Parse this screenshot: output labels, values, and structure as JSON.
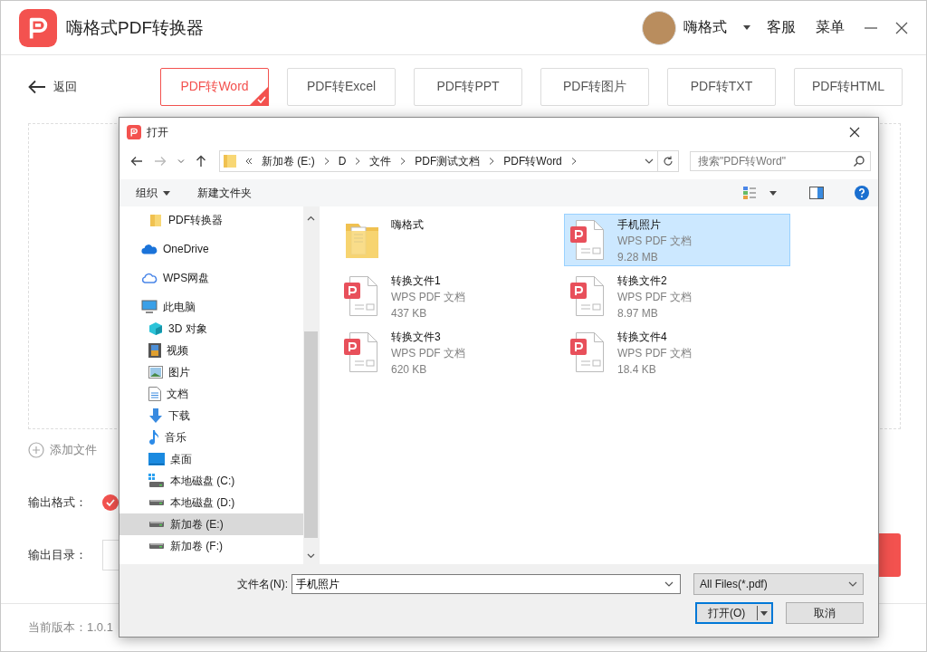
{
  "app": {
    "title": "嗨格式PDF转换器",
    "user_name": "嗨格式",
    "header_links": [
      "客服",
      "菜单"
    ]
  },
  "back_label": "返回",
  "tabs": [
    {
      "label": "PDF转Word",
      "selected": true
    },
    {
      "label": "PDF转Excel",
      "selected": false
    },
    {
      "label": "PDF转PPT",
      "selected": false
    },
    {
      "label": "PDF转图片",
      "selected": false
    },
    {
      "label": "PDF转TXT",
      "selected": false
    },
    {
      "label": "PDF转HTML",
      "selected": false
    }
  ],
  "add_file": "添加文件",
  "output_format": {
    "label": "输出格式："
  },
  "output_folder": {
    "label": "输出目录："
  },
  "version": "当前版本：1.0.1",
  "dialog": {
    "title": "打开",
    "path": [
      "新加卷 (E:)",
      "D",
      "文件",
      "PDF测试文档",
      "PDF转Word"
    ],
    "search": {
      "placeholder": "搜索\"PDF转Word\""
    },
    "toolbar": [
      "组织",
      "新建文件夹"
    ],
    "nav": [
      {
        "label": "PDF转换器",
        "kind": "folder",
        "selected": false
      },
      {
        "label": "OneDrive",
        "kind": "onedrive",
        "selected": false
      },
      {
        "label": "WPS网盘",
        "kind": "cloud",
        "selected": false
      },
      {
        "label": "此电脑",
        "kind": "computer",
        "selected": false,
        "children": [
          {
            "label": "3D 对象",
            "kind": "cube",
            "selected": false
          },
          {
            "label": "视频",
            "kind": "video",
            "selected": false
          },
          {
            "label": "图片",
            "kind": "pictures",
            "selected": false
          },
          {
            "label": "文档",
            "kind": "documents",
            "selected": false
          },
          {
            "label": "下载",
            "kind": "downloads",
            "selected": false
          },
          {
            "label": "音乐",
            "kind": "music",
            "selected": false
          },
          {
            "label": "桌面",
            "kind": "desktop",
            "selected": false
          },
          {
            "label": "本地磁盘 (C:)",
            "kind": "system-drive",
            "selected": false
          },
          {
            "label": "本地磁盘 (D:)",
            "kind": "drive",
            "selected": false
          },
          {
            "label": "新加卷 (E:)",
            "kind": "drive",
            "selected": true
          },
          {
            "label": "新加卷 (F:)",
            "kind": "drive",
            "selected": false
          }
        ]
      }
    ],
    "files": [
      {
        "name": "嗨格式",
        "kind": "folder",
        "selected": false
      },
      {
        "name": "手机照片",
        "kind": "pdf",
        "type": "WPS PDF 文档",
        "size": "9.28 MB",
        "selected": true
      },
      {
        "name": "转换文件1",
        "kind": "pdf",
        "type": "WPS PDF 文档",
        "size": "437 KB",
        "selected": false
      },
      {
        "name": "转换文件2",
        "kind": "pdf",
        "type": "WPS PDF 文档",
        "size": "8.97 MB",
        "selected": false
      },
      {
        "name": "转换文件3",
        "kind": "pdf",
        "type": "WPS PDF 文档",
        "size": "620 KB",
        "selected": false
      },
      {
        "name": "转换文件4",
        "kind": "pdf",
        "type": "WPS PDF 文档",
        "size": "18.4 KB",
        "selected": false
      }
    ],
    "filename": {
      "label": "文件名(N):",
      "value": "手机照片"
    },
    "filetype": "All Files(*.pdf)",
    "buttons": [
      "打开(O)",
      "取消"
    ]
  }
}
